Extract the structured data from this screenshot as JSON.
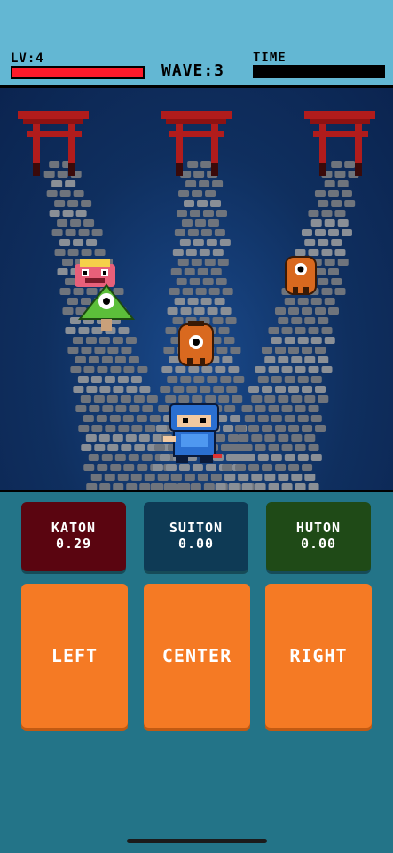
{
  "hud": {
    "level_label": "LV:4",
    "wave_label": "WAVE:3",
    "time_label": "TIME",
    "health_fraction": 1.0,
    "time_fraction": 0.0,
    "health_color": "#ff1a2a"
  },
  "jutsu": [
    {
      "name": "KATON",
      "value": "0.29",
      "color": "#5a0510"
    },
    {
      "name": "SUITON",
      "value": "0.00",
      "color": "#0e3a55"
    },
    {
      "name": "HUTON",
      "value": "0.00",
      "color": "#1f4a17"
    }
  ],
  "controls": {
    "left": "LEFT",
    "center": "CENTER",
    "right": "RIGHT",
    "button_color": "#f57a24"
  },
  "scene": {
    "player": "blue-ninja",
    "enemies": [
      "pink-blob-yokai",
      "green-cyclops-yokai",
      "orange-lantern-yokai",
      "orange-lantern-yokai"
    ],
    "gates": [
      "torii-gate",
      "torii-gate",
      "torii-gate"
    ]
  }
}
